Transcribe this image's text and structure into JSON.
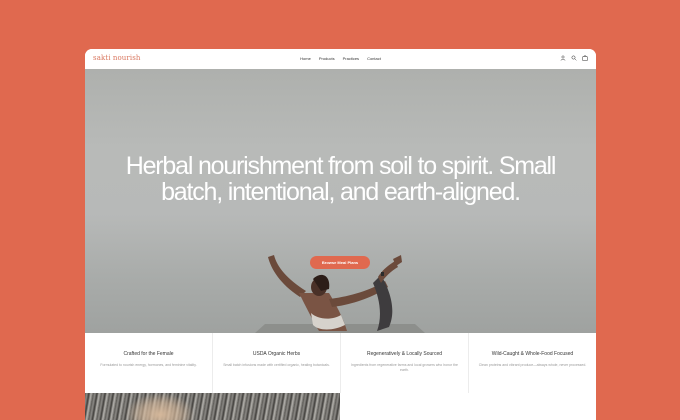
{
  "brand": {
    "logo_text": "sakti nourish"
  },
  "nav": {
    "items": [
      {
        "label": "Home"
      },
      {
        "label": "Products"
      },
      {
        "label": "Practices"
      },
      {
        "label": "Contact"
      }
    ],
    "icons": [
      "user-icon",
      "search-icon",
      "bag-icon"
    ]
  },
  "hero": {
    "title": "Herbal nourishment from soil to spirit. Small batch, intentional, and earth-aligned.",
    "cta_label": "Browse Meal Plans"
  },
  "features": [
    {
      "title": "Crafted for the Female",
      "desc": "Formulated to nourish energy, hormones, and feminine vitality."
    },
    {
      "title": "USDA Organic Herbs",
      "desc": "Small batch infusions made with certified organic, healing botanicals."
    },
    {
      "title": "Regeneratively & Locally Sourced",
      "desc": "Ingredients from regenerative farms and local growers who honor the earth."
    },
    {
      "title": "Wild-Caught & Whole-Food Focused",
      "desc": "Clean proteins and vibrant produce—always whole, never processed."
    }
  ],
  "colors": {
    "accent": "#e0694f",
    "logo": "#d9775f"
  }
}
